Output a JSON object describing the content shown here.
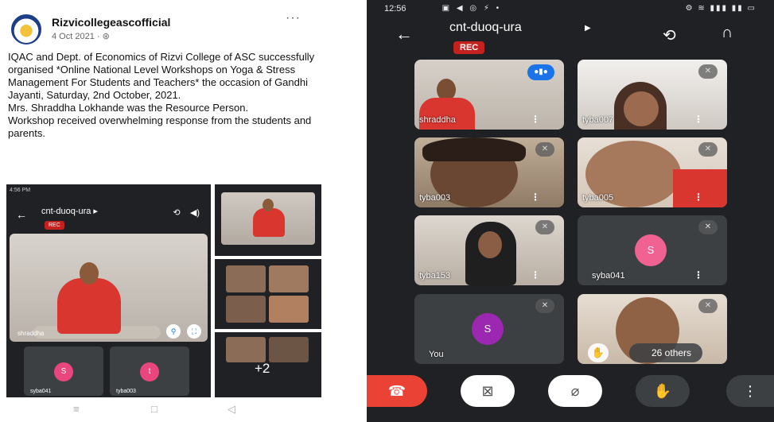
{
  "post": {
    "page_name": "Rizvicollegeascofficial",
    "date": "4 Oct 2021 · ",
    "globe_icon": "globe-icon",
    "more_label": "···",
    "paragraphs": [
      "IQAC and Dept. of Economics of Rizvi College of ASC successfully organised *Online National Level Workshops on Yoga & Stress Management For Students and Teachers* the occasion of Gandhi Jayanti, Saturday, 2nd October, 2021.",
      "Mrs. Shraddha Lokhande was the Resource Person.",
      "Workshop received overwhelming response from the students and parents."
    ]
  },
  "mini": {
    "status_time": "4:56 PM",
    "title": "cnt-duoq-ura",
    "rec": "REC",
    "main_name": "shraddha",
    "tiles": [
      {
        "initial": "S",
        "name": "syba041",
        "color": "#e8467c"
      },
      {
        "initial": "t",
        "name": "tyba003",
        "color": "#e8467c"
      }
    ],
    "plus_more": "+2"
  },
  "meet": {
    "status_time": "12:56",
    "title": "cnt-duoq-ura",
    "rec": "REC",
    "participants": [
      {
        "name": "shraddha",
        "state": "speaking"
      },
      {
        "name": "tyba007",
        "state": "muted"
      },
      {
        "name": "tyba003",
        "state": "muted"
      },
      {
        "name": "tyba005",
        "state": "muted"
      },
      {
        "name": "tyba153",
        "state": "muted"
      },
      {
        "name": "syba041",
        "state": "muted",
        "initial": "S",
        "color": "#f06292"
      },
      {
        "name": "You",
        "state": "muted",
        "initial": "S",
        "color": "#9c27b0"
      }
    ],
    "others_label": "26 others",
    "controls": {
      "end_call": "end-call-icon",
      "camera": "camera-off-icon",
      "mic": "mic-off-icon",
      "hand": "raise-hand-icon",
      "more": "more-vertical-icon"
    },
    "colors": {
      "end_call": "#ea4335",
      "rec": "#c5221f",
      "speaking": "#1a73e8"
    }
  }
}
